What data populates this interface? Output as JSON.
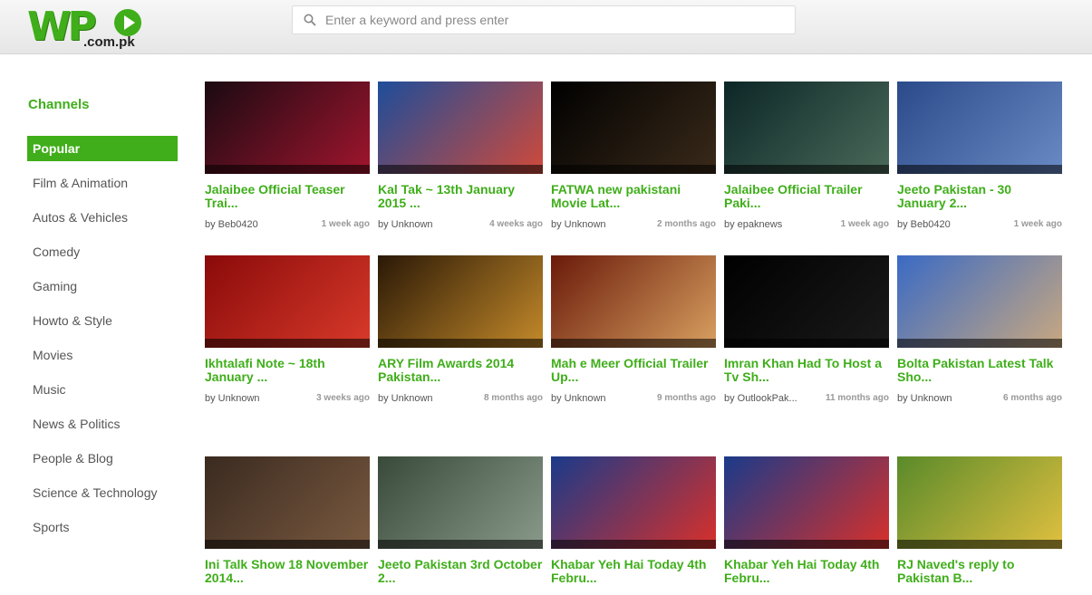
{
  "site": {
    "logo_main": "WP",
    "logo_domain": ".com.pk"
  },
  "search": {
    "placeholder": "Enter a keyword and press enter"
  },
  "sidebar": {
    "heading": "Channels",
    "items": [
      {
        "label": "Popular",
        "active": true
      },
      {
        "label": "Film & Animation"
      },
      {
        "label": "Autos & Vehicles"
      },
      {
        "label": "Comedy"
      },
      {
        "label": "Gaming"
      },
      {
        "label": "Howto & Style"
      },
      {
        "label": "Movies"
      },
      {
        "label": "Music"
      },
      {
        "label": "News & Politics"
      },
      {
        "label": "People & Blog"
      },
      {
        "label": "Science & Technology"
      },
      {
        "label": "Sports"
      }
    ]
  },
  "videos": [
    {
      "title": "Jalaibee Official Teaser Trai...",
      "by": "by Beb0420",
      "ago": "1 week ago",
      "thumb": [
        "#1a0a12",
        "#a0152e"
      ]
    },
    {
      "title": "Kal Tak ~ 13th January 2015 ...",
      "by": "by Unknown",
      "ago": "4 weeks ago",
      "thumb": [
        "#1d4d9a",
        "#d04a3a"
      ]
    },
    {
      "title": "FATWA new pakistani Movie Lat...",
      "by": "by Unknown",
      "ago": "2 months ago",
      "thumb": [
        "#000000",
        "#3a2a1a"
      ]
    },
    {
      "title": "Jalaibee Official Trailer Paki...",
      "by": "by epaknews",
      "ago": "1 week ago",
      "thumb": [
        "#0c2626",
        "#4a6a5a"
      ]
    },
    {
      "title": "Jeeto Pakistan - 30 January 2...",
      "by": "by Beb0420",
      "ago": "1 week ago",
      "thumb": [
        "#2a4a8a",
        "#6a8ac4"
      ]
    },
    {
      "title": "Ikhtalafi Note ~ 18th January ...",
      "by": "by Unknown",
      "ago": "3 weeks ago",
      "thumb": [
        "#8a0a0a",
        "#d83a2a"
      ]
    },
    {
      "title": "ARY Film Awards 2014 Pakistan...",
      "by": "by Unknown",
      "ago": "8 months ago",
      "thumb": [
        "#2a1806",
        "#c48a2a"
      ]
    },
    {
      "title": "Mah e Meer Official Trailer Up...",
      "by": "by Unknown",
      "ago": "9 months ago",
      "thumb": [
        "#6a1a0a",
        "#d8a060"
      ]
    },
    {
      "title": "Imran Khan Had To Host a Tv Sh...",
      "by": "by OutlookPak...",
      "ago": "11 months ago",
      "thumb": [
        "#000000",
        "#1a1a1a"
      ]
    },
    {
      "title": "Bolta Pakistan Latest Talk Sho...",
      "by": "by Unknown",
      "ago": "6 months ago",
      "thumb": [
        "#3a6ac4",
        "#c8a880"
      ]
    },
    {
      "title": "Ini Talk Show 18 November 2014...",
      "by": "",
      "ago": "",
      "thumb": [
        "#3a2a20",
        "#7a5a40"
      ]
    },
    {
      "title": "Jeeto Pakistan 3rd October 2...",
      "by": "",
      "ago": "",
      "thumb": [
        "#3a4a3a",
        "#8a9a8a"
      ]
    },
    {
      "title": "Khabar Yeh Hai Today 4th Febru...",
      "by": "",
      "ago": "",
      "thumb": [
        "#1a3a8a",
        "#d8302a"
      ]
    },
    {
      "title": "Khabar Yeh Hai Today 4th Febru...",
      "by": "",
      "ago": "",
      "thumb": [
        "#1a3a8a",
        "#d8302a"
      ]
    },
    {
      "title": "RJ Naved's reply to Pakistan B...",
      "by": "",
      "ago": "",
      "thumb": [
        "#5a8a2a",
        "#e0c040"
      ]
    }
  ],
  "colors": {
    "accent": "#3fae1a"
  }
}
